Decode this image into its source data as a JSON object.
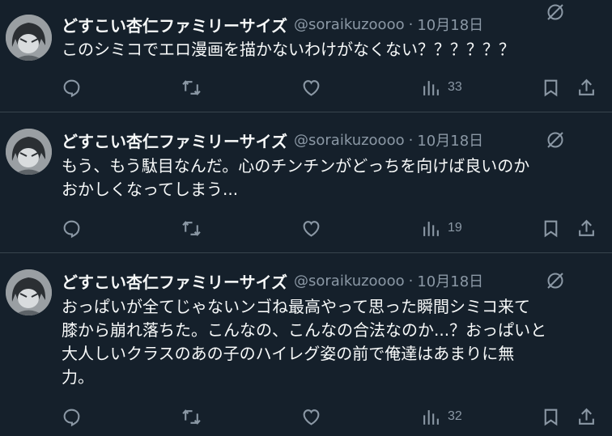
{
  "tweets": [
    {
      "author_name": "どすこい杏仁ファミリーサイズ",
      "handle": "@soraikuzoooo",
      "separator": "·",
      "date": "10月18日",
      "text": "このシミコでエロ漫画を描かないわけがなくない？？？？？？",
      "views": "33"
    },
    {
      "author_name": "どすこい杏仁ファミリーサイズ",
      "handle": "@soraikuzoooo",
      "separator": "·",
      "date": "10月18日",
      "text": "もう、もう駄目なんだ。心のチンチンがどっちを向けば良いのか\nおかしくなってしまう...",
      "views": "19"
    },
    {
      "author_name": "どすこい杏仁ファミリーサイズ",
      "handle": "@soraikuzoooo",
      "separator": "·",
      "date": "10月18日",
      "text": "おっぱいが全てじゃないンゴね最高やって思った瞬間シミコ来て\n膝から崩れ落ちた。こんなの、こんなの合法なのか...？おっぱいと\n大人しいクラスのあの子のハイレグ姿の前で俺達はあまりに無\n力。",
      "views": "32"
    }
  ],
  "icons": {
    "reply": "reply-icon",
    "retweet": "retweet-icon",
    "like": "like-icon",
    "views": "views-icon",
    "bookmark": "bookmark-icon",
    "share": "share-icon",
    "grok": "grok-icon"
  },
  "colors": {
    "background": "#15202b",
    "primary_text": "#f7f9f9",
    "secondary_text": "#8b98a5",
    "divider": "#38444d"
  }
}
